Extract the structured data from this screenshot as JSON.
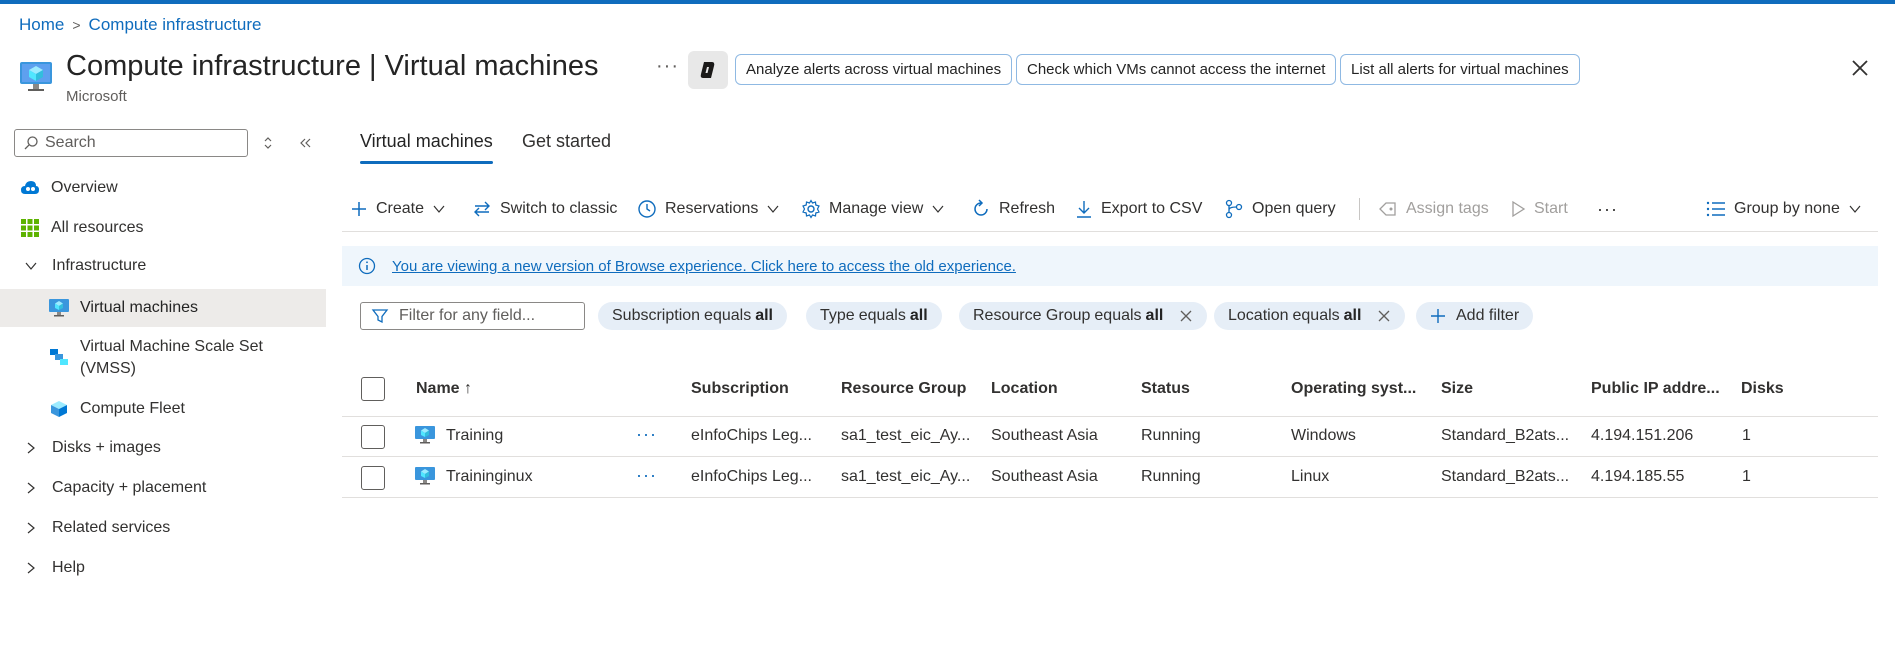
{
  "breadcrumb": {
    "home": "Home",
    "current": "Compute infrastructure"
  },
  "header": {
    "title": "Compute infrastructure | Virtual machines",
    "subtitle": "Microsoft",
    "more": "···",
    "chips": [
      "Analyze alerts across virtual machines",
      "Check which VMs cannot access the internet",
      "List all alerts for virtual machines"
    ]
  },
  "sidebar": {
    "search_placeholder": "Search",
    "items": [
      {
        "label": "Overview"
      },
      {
        "label": "All resources"
      },
      {
        "label": "Infrastructure"
      },
      {
        "label": "Virtual machines"
      },
      {
        "label_line1": "Virtual Machine Scale Set",
        "label_line2": "(VMSS)"
      },
      {
        "label": "Compute Fleet"
      },
      {
        "label": "Disks + images"
      },
      {
        "label": "Capacity + placement"
      },
      {
        "label": "Related services"
      },
      {
        "label": "Help"
      }
    ]
  },
  "tabs": [
    "Virtual machines",
    "Get started"
  ],
  "toolbar": {
    "create": "Create",
    "switch_classic": "Switch to classic",
    "reservations": "Reservations",
    "manage_view": "Manage view",
    "refresh": "Refresh",
    "export_csv": "Export to CSV",
    "open_query": "Open query",
    "assign_tags": "Assign tags",
    "start": "Start",
    "more": "···",
    "group_by": "Group by none"
  },
  "banner": {
    "text": "You are viewing a new version of Browse experience. Click here to access the old experience."
  },
  "filters": {
    "placeholder": "Filter for any field...",
    "pills": [
      {
        "field": "Subscription",
        "op": "equals",
        "value": "all"
      },
      {
        "field": "Type",
        "op": "equals",
        "value": "all"
      },
      {
        "field": "Resource Group",
        "op": "equals",
        "value": "all"
      },
      {
        "field": "Location",
        "op": "equals",
        "value": "all"
      }
    ],
    "add_filter": "Add filter"
  },
  "table": {
    "columns": [
      "Name ↑",
      "Subscription",
      "Resource Group",
      "Location",
      "Status",
      "Operating syst...",
      "Size",
      "Public IP addre...",
      "Disks"
    ],
    "rows": [
      {
        "name": "Training",
        "subscription": "eInfoChips Leg...",
        "resource_group": "sa1_test_eic_Ay...",
        "location": "Southeast Asia",
        "status": "Running",
        "os": "Windows",
        "size": "Standard_B2ats...",
        "ip": "4.194.151.206",
        "disks": "1"
      },
      {
        "name": "Traininginux",
        "subscription": "eInfoChips Leg...",
        "resource_group": "sa1_test_eic_Ay...",
        "location": "Southeast Asia",
        "status": "Running",
        "os": "Linux",
        "size": "Standard_B2ats...",
        "ip": "4.194.185.55",
        "disks": "1"
      }
    ],
    "row_more": "···"
  },
  "colors": {
    "accent": "#0f6cbd",
    "pill_bg": "#e6eef7",
    "banner_bg": "#eff6fc",
    "selected_bg": "#edebe9"
  }
}
